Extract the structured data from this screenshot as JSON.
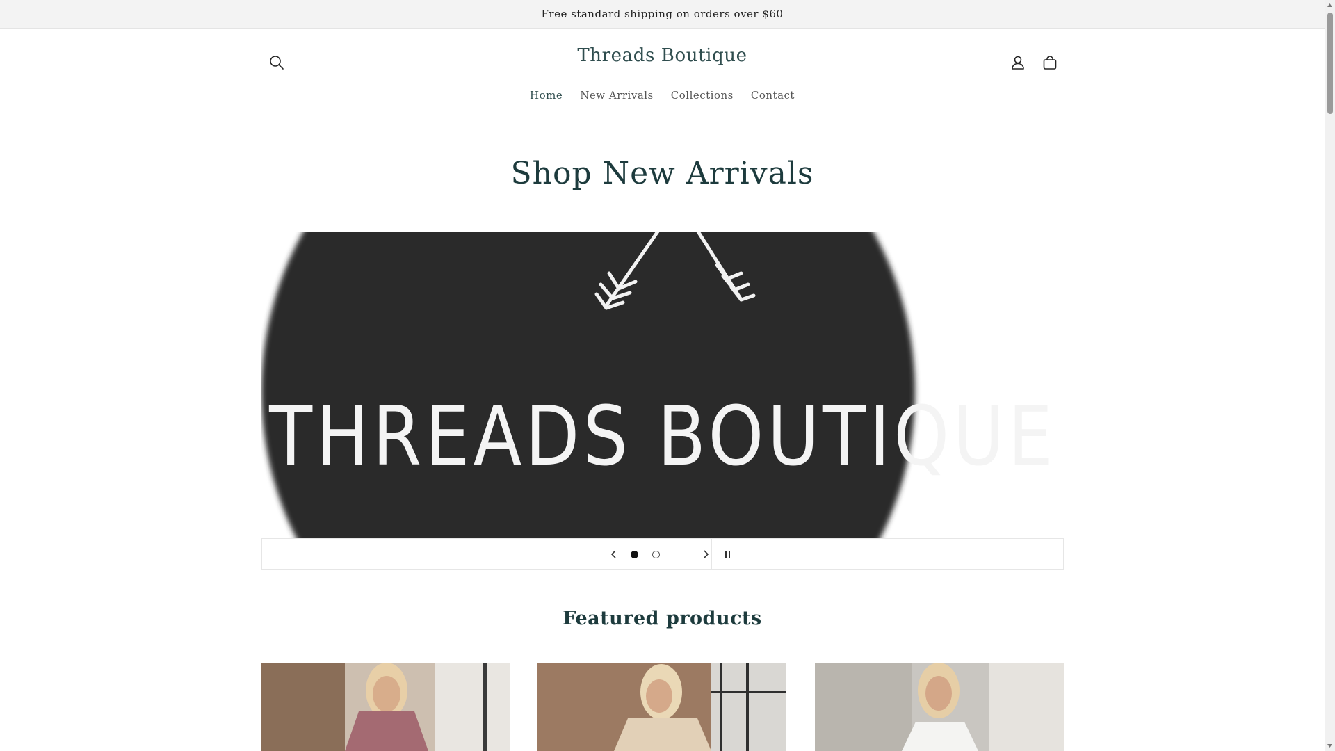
{
  "announcement": {
    "text": "Free standard shipping on orders over $60"
  },
  "header": {
    "title": "Threads Boutique",
    "icons": {
      "search": "search-icon",
      "account": "user-icon",
      "cart": "cart-icon"
    }
  },
  "nav": {
    "items": [
      {
        "label": "Home",
        "active": true
      },
      {
        "label": "New Arrivals",
        "active": false
      },
      {
        "label": "Collections",
        "active": false
      },
      {
        "label": "Contact",
        "active": false
      }
    ]
  },
  "hero": {
    "heading": "Shop New Arrivals"
  },
  "slideshow": {
    "logo_text": "THREADS BOUTIQUE",
    "slide_count": 2,
    "current_slide": 1,
    "icons": {
      "prev": "chevron-left-icon",
      "next": "chevron-right-icon",
      "pause": "pause-icon"
    }
  },
  "featured": {
    "heading": "Featured products"
  },
  "colors": {
    "accent": "#2f4d4e",
    "heading": "#1d3b3d",
    "announcement_bg": "#f3f3f3",
    "logo_circle": "#2a2a2a"
  }
}
